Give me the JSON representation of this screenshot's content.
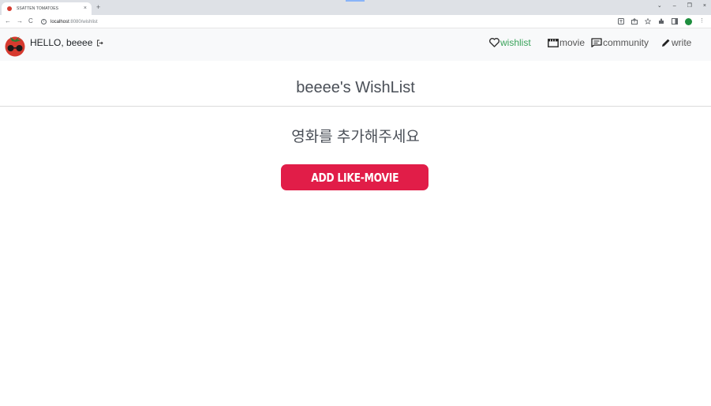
{
  "browser": {
    "tab_title": "SSATTEN TOMATOES",
    "tab_close": "×",
    "new_tab": "+",
    "back": "←",
    "forward": "→",
    "reload": "C",
    "url_host": "localhost",
    "url_path": ":8080/wishlist",
    "window_controls": {
      "collapse": "⌄",
      "minimize": "–",
      "restore": "❐",
      "close": "×"
    }
  },
  "navbar": {
    "greeting": "HELLO, beeee",
    "links": [
      {
        "label": "wishlist",
        "icon": "heart-icon",
        "active": true
      },
      {
        "label": "movie",
        "icon": "clapperboard-icon",
        "active": false
      },
      {
        "label": "community",
        "icon": "message-icon",
        "active": false
      },
      {
        "label": "write",
        "icon": "pencil-icon",
        "active": false
      }
    ]
  },
  "main": {
    "title": "beeee's WishList",
    "empty_message": "영화를 추가해주세요",
    "add_button_label": "ADD LIKE-MOVIE"
  },
  "colors": {
    "accent": "#e11d48",
    "active_link": "#3aa35a",
    "logo_red": "#d63a2f"
  }
}
